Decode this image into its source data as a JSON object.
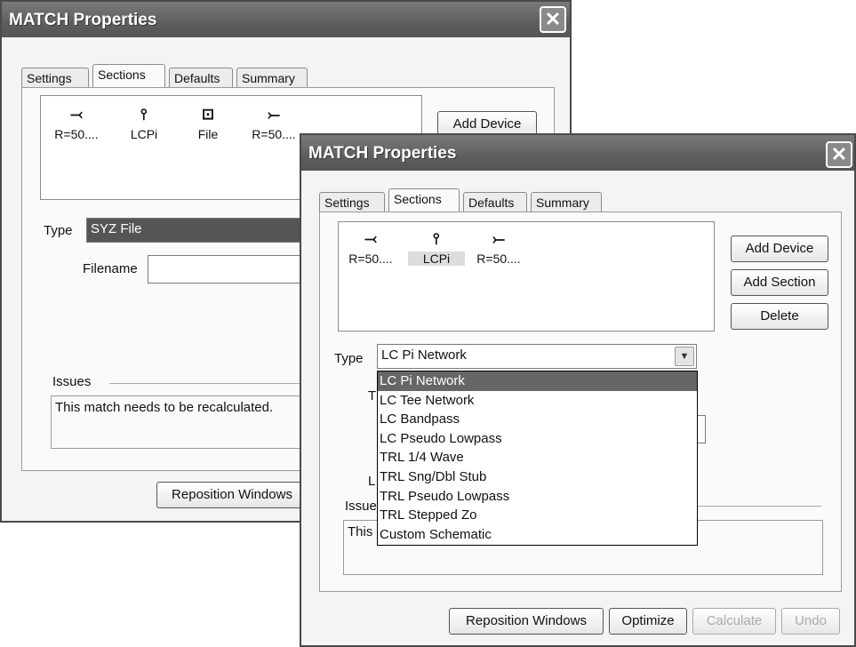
{
  "back_window": {
    "title": "MATCH Properties",
    "tabs": [
      "Settings",
      "Sections",
      "Defaults",
      "Summary"
    ],
    "devices": [
      {
        "icon": "⤙",
        "label": "R=50...."
      },
      {
        "icon": "⫯",
        "label": "LCPi"
      },
      {
        "icon": "⊡",
        "label": "File"
      },
      {
        "icon": "⤚",
        "label": "R=50...."
      }
    ],
    "add_device_label": "Add Device",
    "type_label": "Type",
    "type_value": "SYZ File",
    "filename_label": "Filename",
    "filename_value": "",
    "issues_label": "Issues",
    "issues_text": "This match needs to be recalculated.",
    "reposition_label": "Reposition Windows"
  },
  "front_window": {
    "title": "MATCH Properties",
    "tabs": [
      "Settings",
      "Sections",
      "Defaults",
      "Summary"
    ],
    "devices": [
      {
        "icon": "⤙",
        "label": "R=50...."
      },
      {
        "icon": "⫯",
        "label": "LCPi"
      },
      {
        "icon": "⤚",
        "label": "R=50...."
      }
    ],
    "add_device_label": "Add Device",
    "add_section_label": "Add Section",
    "delete_label": "Delete",
    "type_label": "Type",
    "type_value": "LC Pi Network",
    "dropdown_options": [
      "LC Pi Network",
      "LC Tee Network",
      "LC Bandpass",
      "LC Pseudo Lowpass",
      "TRL 1/4 Wave",
      "TRL Sng/Dbl Stub",
      "TRL Pseudo Lowpass",
      "TRL Stepped Zo",
      "Custom Schematic"
    ],
    "selected_option_index": 0,
    "partial_labels": [
      "T",
      "L"
    ],
    "issues_label_partial": "Issue",
    "issues_text_partial": "This",
    "buttons": {
      "reposition": "Reposition Windows",
      "optimize": "Optimize",
      "calculate": "Calculate",
      "undo": "Undo"
    }
  }
}
